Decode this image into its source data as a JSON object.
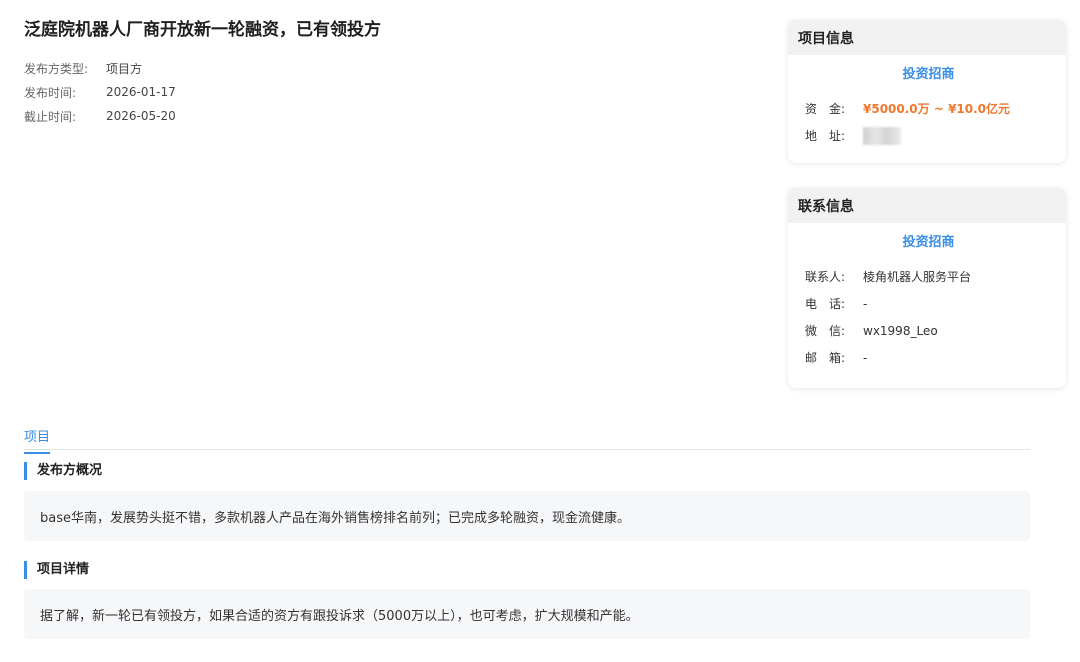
{
  "project": {
    "title": "泛庭院机器人厂商开放新一轮融资，已有领投方",
    "meta": [
      {
        "label": "发布方类型:",
        "value": "项目方"
      },
      {
        "label": "发布时间:",
        "value": "2026-01-17"
      },
      {
        "label": "截止时间:",
        "value": "2026-05-20"
      }
    ]
  },
  "project_info": {
    "header": "项目信息",
    "link": "投资招商",
    "fund_label": "资　金:",
    "fund_value": "¥5000.0万 ~ ¥10.0亿元",
    "address_label": "地　址:"
  },
  "contact_info": {
    "header": "联系信息",
    "link": "投资招商",
    "rows": [
      {
        "label": "联系人:",
        "value": "棱角机器人服务平台"
      },
      {
        "label": "电　话:",
        "value": "-"
      },
      {
        "label": "微　信:",
        "value": "wx1998_Leo"
      },
      {
        "label": "邮　箱:",
        "value": "-"
      }
    ]
  },
  "tabs": [
    {
      "label": "项目"
    }
  ],
  "sections": [
    {
      "title": "发布方概况",
      "content": "base华南，发展势头挺不错，多款机器人产品在海外销售榜排名前列；已完成多轮融资，现金流健康。"
    },
    {
      "title": "项目详情",
      "content": "据了解，新一轮已有领投方，如果合适的资方有跟投诉求（5000万以上），也可考虑，扩大规模和产能。"
    }
  ],
  "colors": {
    "accent": "#3a8ee6",
    "money": "#f0782d"
  }
}
